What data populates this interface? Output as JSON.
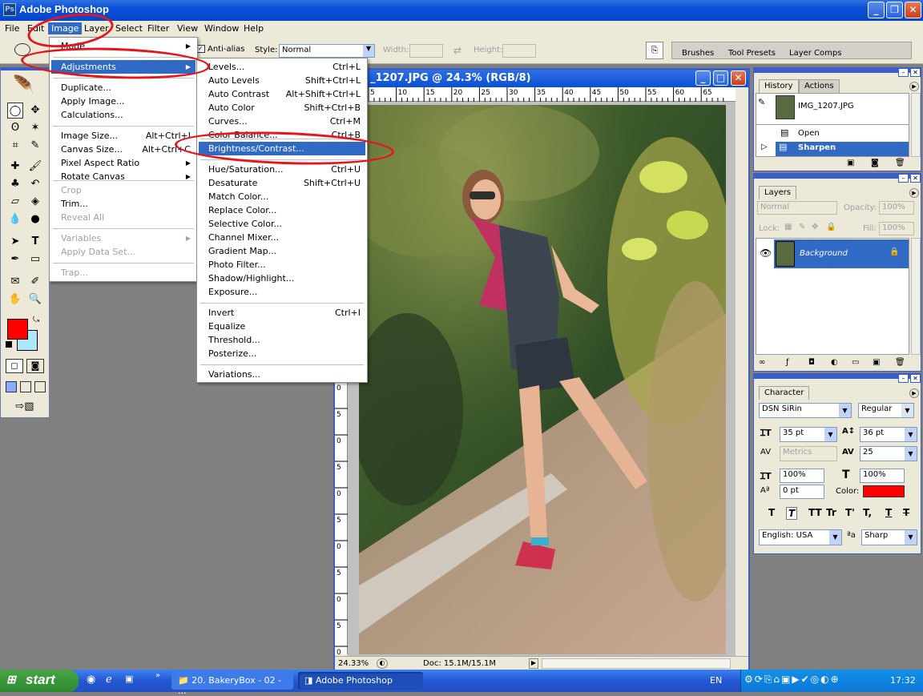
{
  "window": {
    "title": "Adobe Photoshop",
    "icon": "photoshop-icon"
  },
  "menubar": [
    "File",
    "Edit",
    "Image",
    "Layer",
    "Select",
    "Filter",
    "View",
    "Window",
    "Help"
  ],
  "options": {
    "antialias_label": "Anti-alias",
    "style_label": "Style:",
    "style_value": "Normal",
    "width_label": "Width:",
    "height_label": "Height:",
    "palette_tabs": [
      "Brushes",
      "Tool Presets",
      "Layer Comps"
    ]
  },
  "image_menu": {
    "items": [
      {
        "label": "Mode",
        "shortcut": "",
        "submenu": true
      },
      {
        "label": "Adjustments",
        "shortcut": "",
        "submenu": true,
        "highlight": true
      },
      {
        "label": "Duplicate...",
        "shortcut": ""
      },
      {
        "label": "Apply Image...",
        "shortcut": ""
      },
      {
        "label": "Calculations...",
        "shortcut": ""
      },
      {
        "label": "Image Size...",
        "shortcut": "Alt+Ctrl+I"
      },
      {
        "label": "Canvas Size...",
        "shortcut": "Alt+Ctrl+C"
      },
      {
        "label": "Pixel Aspect Ratio",
        "shortcut": "",
        "submenu": true
      },
      {
        "label": "Rotate Canvas",
        "shortcut": "",
        "submenu": true
      },
      {
        "label": "Crop",
        "shortcut": "",
        "disabled": true
      },
      {
        "label": "Trim...",
        "shortcut": ""
      },
      {
        "label": "Reveal All",
        "shortcut": "",
        "disabled": true
      },
      {
        "label": "Variables",
        "shortcut": "",
        "submenu": true,
        "disabled": true
      },
      {
        "label": "Apply Data Set...",
        "shortcut": "",
        "disabled": true
      },
      {
        "label": "Trap...",
        "shortcut": "",
        "disabled": true
      }
    ]
  },
  "adjustments_menu": {
    "items": [
      {
        "label": "Levels...",
        "shortcut": "Ctrl+L"
      },
      {
        "label": "Auto Levels",
        "shortcut": "Shift+Ctrl+L"
      },
      {
        "label": "Auto Contrast",
        "shortcut": "Alt+Shift+Ctrl+L"
      },
      {
        "label": "Auto Color",
        "shortcut": "Shift+Ctrl+B"
      },
      {
        "label": "Curves...",
        "shortcut": "Ctrl+M"
      },
      {
        "label": "Color Balance...",
        "shortcut": "Ctrl+B"
      },
      {
        "label": "Brightness/Contrast...",
        "shortcut": "",
        "highlight": true
      },
      {
        "label": "Hue/Saturation...",
        "shortcut": "Ctrl+U"
      },
      {
        "label": "Desaturate",
        "shortcut": "Shift+Ctrl+U"
      },
      {
        "label": "Match Color...",
        "shortcut": ""
      },
      {
        "label": "Replace Color...",
        "shortcut": ""
      },
      {
        "label": "Selective Color...",
        "shortcut": ""
      },
      {
        "label": "Channel Mixer...",
        "shortcut": ""
      },
      {
        "label": "Gradient Map...",
        "shortcut": ""
      },
      {
        "label": "Photo Filter...",
        "shortcut": ""
      },
      {
        "label": "Shadow/Highlight...",
        "shortcut": ""
      },
      {
        "label": "Exposure...",
        "shortcut": ""
      },
      {
        "label": "Invert",
        "shortcut": "Ctrl+I"
      },
      {
        "label": "Equalize",
        "shortcut": ""
      },
      {
        "label": "Threshold...",
        "shortcut": ""
      },
      {
        "label": "Posterize...",
        "shortcut": ""
      },
      {
        "label": "Variations...",
        "shortcut": ""
      }
    ]
  },
  "document": {
    "title": "_1207.JPG @ 24.3% (RGB/8)",
    "ruler_marks": [
      "5",
      "10",
      "15",
      "20",
      "25",
      "30",
      "35",
      "40",
      "45",
      "50",
      "55",
      "60",
      "65"
    ],
    "vruler_marks": [
      "0",
      "5",
      "0",
      "5",
      "0",
      "5",
      "0",
      "5",
      "0",
      "5",
      "0",
      "5",
      "0",
      "5"
    ],
    "zoom": "24.33%",
    "doc_size": "Doc: 15.1M/15.1M"
  },
  "history": {
    "tabs": [
      "History",
      "Actions"
    ],
    "snapshot": "IMG_1207.JPG",
    "steps": [
      {
        "label": "Open"
      },
      {
        "label": "Sharpen",
        "active": true
      }
    ]
  },
  "layers": {
    "tab": "Layers",
    "blend_mode": "Normal",
    "opacity_label": "Opacity:",
    "opacity": "100%",
    "lock_label": "Lock:",
    "fill_label": "Fill:",
    "fill": "100%",
    "layer_name": "Background"
  },
  "character": {
    "tab": "Character",
    "font": "DSN SiRin",
    "style": "Regular",
    "size": "35 pt",
    "leading": "36 pt",
    "kerning": "Metrics",
    "tracking": "25",
    "vscale": "100%",
    "hscale": "100%",
    "baseline": "0 pt",
    "color_label": "Color:",
    "color": "#ff0000",
    "style_buttons": [
      "T",
      "T",
      "TT",
      "Tr",
      "T'",
      "T,",
      "T",
      "T"
    ],
    "language": "English: USA",
    "aa_label": "a",
    "antialias": "Sharp"
  },
  "toolbox": {
    "fg_color": "#ff0000",
    "bg_color": "#aee8f8"
  },
  "taskbar": {
    "start": "start",
    "buttons": [
      "20. BakeryBox - 02 - ...",
      "Adobe Photoshop"
    ],
    "lang": "EN",
    "clock": "17:32"
  }
}
